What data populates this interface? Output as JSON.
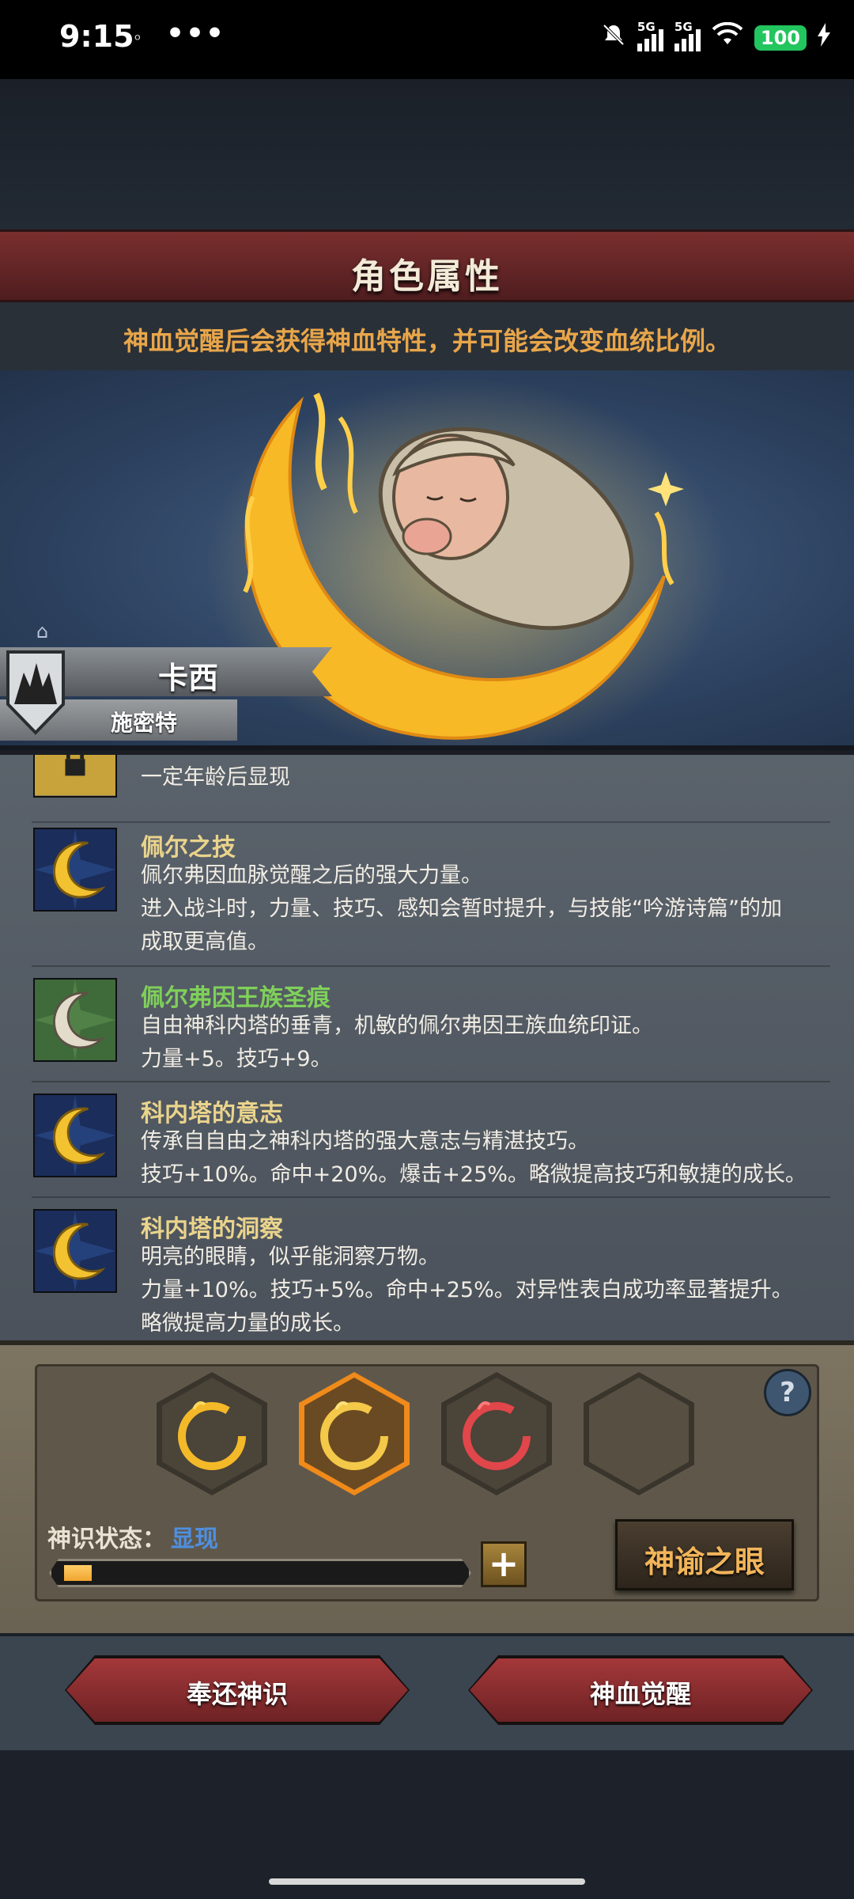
{
  "status_bar": {
    "time": "9:15",
    "small_icon": "ᵒ",
    "dots": "•••",
    "network_label_1": "5G",
    "network_label_2": "5G",
    "battery": "100"
  },
  "header": {
    "title": "角色属性",
    "subtitle": "神血觉醒后会获得神血特性，并可能会改变血统比例。"
  },
  "character": {
    "name": "卡西",
    "class": "施密特"
  },
  "traits": [
    {
      "title": "",
      "icon": "locked-icon",
      "lines": [
        "一定年龄后显现"
      ]
    },
    {
      "title": "佩尔之技",
      "icon": "gold-moon-icon",
      "lines": [
        "佩尔弗因血脉觉醒之后的强大力量。",
        "进入战斗时，力量、技巧、感知会暂时提升，与技能“吟游诗篇”的加",
        "成取更高值。"
      ]
    },
    {
      "title": "佩尔弗因王族圣痕",
      "icon": "silver-moon-icon",
      "lines": [
        "自由神科内塔的垂青，机敏的佩尔弗因王族血统印证。",
        "力量+5。技巧+9。"
      ]
    },
    {
      "title": "科内塔的意志",
      "icon": "gold-moon-icon",
      "lines": [
        "传承自自由之神科内塔的强大意志与精湛技巧。",
        "技巧+10%。命中+20%。爆击+25%。略微提高技巧和敏捷的成长。"
      ]
    },
    {
      "title": "科内塔的洞察",
      "icon": "gold-moon-icon",
      "lines": [
        "明亮的眼睛，似乎能洞察万物。",
        "力量+10%。技巧+5%。命中+25%。对异性表白成功率显著提升。",
        "略微提高力量的成长。"
      ]
    }
  ],
  "divine": {
    "slots": [
      "gold-crescent-icon",
      "gold-crescent-selected-icon",
      "red-crescent-icon",
      "empty-slot"
    ],
    "help": "?",
    "state_label": "神识状态：",
    "state_value": "显现",
    "progress": 0.07,
    "plus": "+",
    "oracle_button": "神谕之眼"
  },
  "actions": {
    "return_button": "奉还神识",
    "awaken_button": "神血觉醒"
  },
  "colors": {
    "accent_gold": "#ead48c",
    "accent_green": "#7fd05a",
    "accent_orange": "#e8a64a",
    "state_blue": "#4f8fe0",
    "button_red": "#a4383a"
  }
}
